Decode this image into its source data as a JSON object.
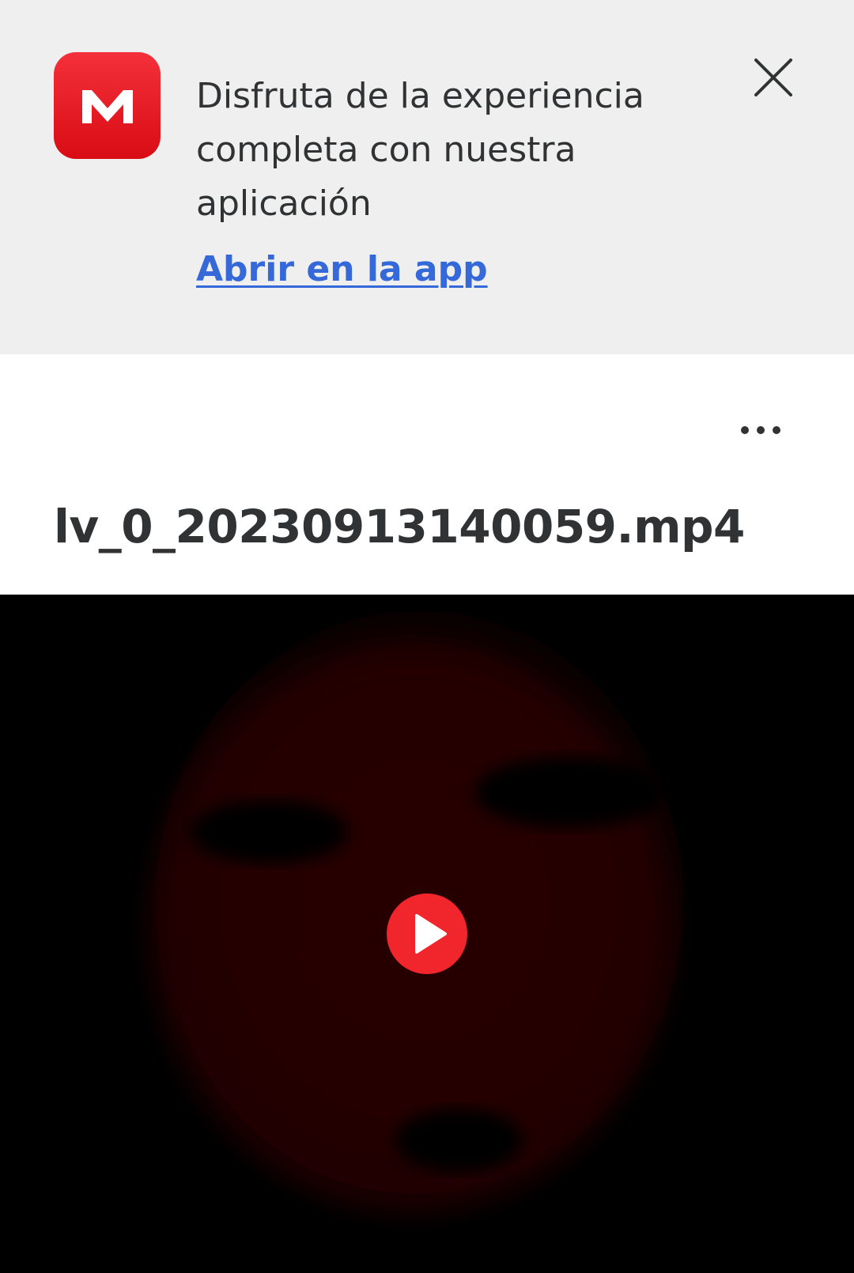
{
  "banner": {
    "app_icon": "mega-logo-icon",
    "message": "Disfruta de la experiencia completa con nuestra aplicación",
    "open_link": "Abrir en la app",
    "close_icon": "close-icon"
  },
  "toolbar": {
    "more_icon": "more-options-icon"
  },
  "file": {
    "name": "lv_0_20230913140059.mp4"
  },
  "player": {
    "play_icon": "play-icon"
  },
  "colors": {
    "brand_red": "#f0262c",
    "link_blue": "#3569d9",
    "banner_bg": "#efefef",
    "text_dark": "#303233"
  }
}
